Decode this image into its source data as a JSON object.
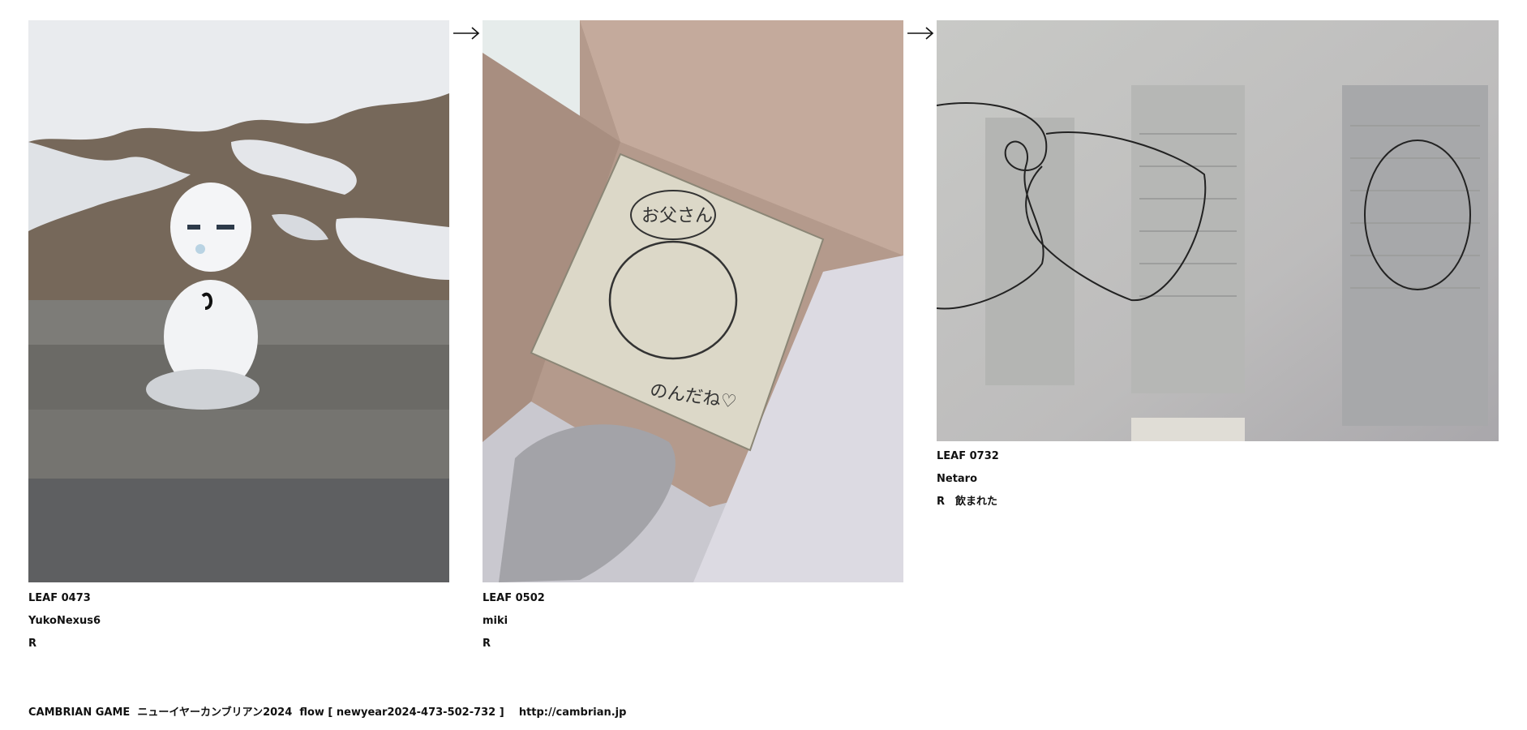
{
  "leaves": [
    {
      "code": "LEAF 0473",
      "author": "YukoNexus6",
      "reply": "R",
      "photo": "snowman-photo"
    },
    {
      "code": "LEAF 0502",
      "author": "miki",
      "reply": "R",
      "photo": "cardboard-box-photo"
    },
    {
      "code": "LEAF 0732",
      "author": "Netaro",
      "reply": "R　飲まれた",
      "photo": "window-drawing-photo"
    }
  ],
  "photo_text": {
    "box_note_top": "お父さん",
    "box_note_bottom": "のんだね♡"
  },
  "footer": {
    "brand": "CAMBRIAN GAME",
    "title": "ニューイヤーカンブリアン2024",
    "flow": "flow [ newyear2024-473-502-732 ]",
    "url": "http://cambrian.jp"
  },
  "icons": [
    "arrow-right-icon",
    "arrow-right-icon"
  ]
}
